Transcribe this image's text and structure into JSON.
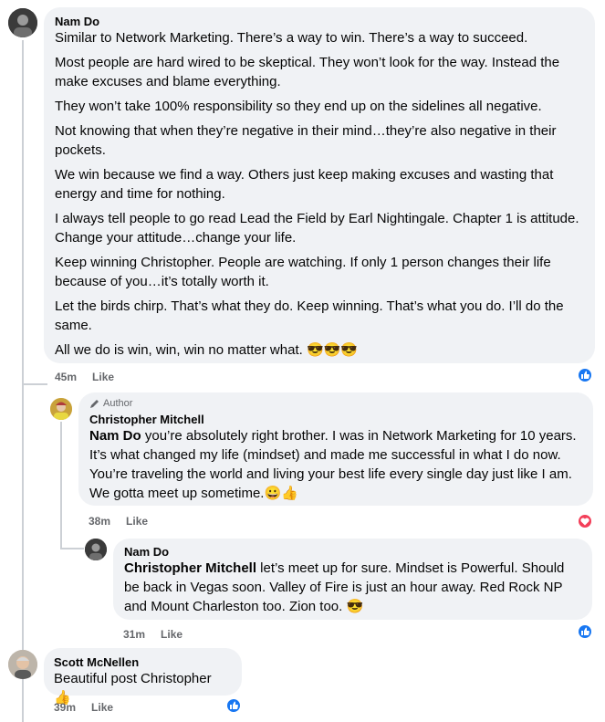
{
  "comments": [
    {
      "author": "Nam Do",
      "paragraphs": [
        "Similar to Network Marketing. There’s a way to win. There’s a way to succeed.",
        "Most people are hard wired to be skeptical. They won’t look for the way. Instead the make excuses and blame everything.",
        "They won’t take 100% responsibility so they end up on the sidelines all negative.",
        "Not knowing that when they’re negative in their mind…they’re also negative in their pockets.",
        "We win because we find a way. Others just keep making excuses and wasting that energy and time for nothing.",
        "I always tell people to go read Lead the Field by Earl Nightingale. Chapter 1 is attitude. Change your attitude…change your life.",
        "Keep winning Christopher. People are watching. If only 1 person changes their life because of you…it’s totally worth it.",
        "Let the birds chirp. That’s what they do. Keep winning. That’s what you do. I’ll do the same.",
        "All we do is win, win, win no matter what. 😎😎😎"
      ],
      "time": "45m",
      "like_label": "Like",
      "reaction": "like-reaction-icon"
    },
    {
      "badge": "Author",
      "author": "Christopher Mitchell",
      "mention": "Nam Do",
      "text": " you’re absolutely right brother. I was in Network Marketing for 10 years. It’s what changed my life (mindset) and made me successful in what I do now. You’re traveling the world and living your best life every single day just like I am. We gotta meet up sometime.😀👍",
      "time": "38m",
      "like_label": "Like",
      "reaction": "love-reaction-icon"
    },
    {
      "author": "Nam Do",
      "mention": "Christopher Mitchell",
      "text": " let’s meet up for sure. Mindset is Powerful. Should be back in Vegas soon. Valley of Fire is just an hour away. Red Rock NP and Mount Charleston too. Zion too. 😎",
      "time": "31m",
      "like_label": "Like",
      "reaction": "like-reaction-icon"
    },
    {
      "author": "Scott McNellen",
      "text": "Beautiful post Christopher 👍",
      "time": "39m",
      "like_label": "Like",
      "reaction": "like-reaction-icon"
    }
  ],
  "colors": {
    "bubble": "#f0f2f5",
    "meta": "#65676b",
    "like_blue": "#1877f2",
    "love_red": "#f33e58",
    "thread_line": "#ccd0d5"
  }
}
